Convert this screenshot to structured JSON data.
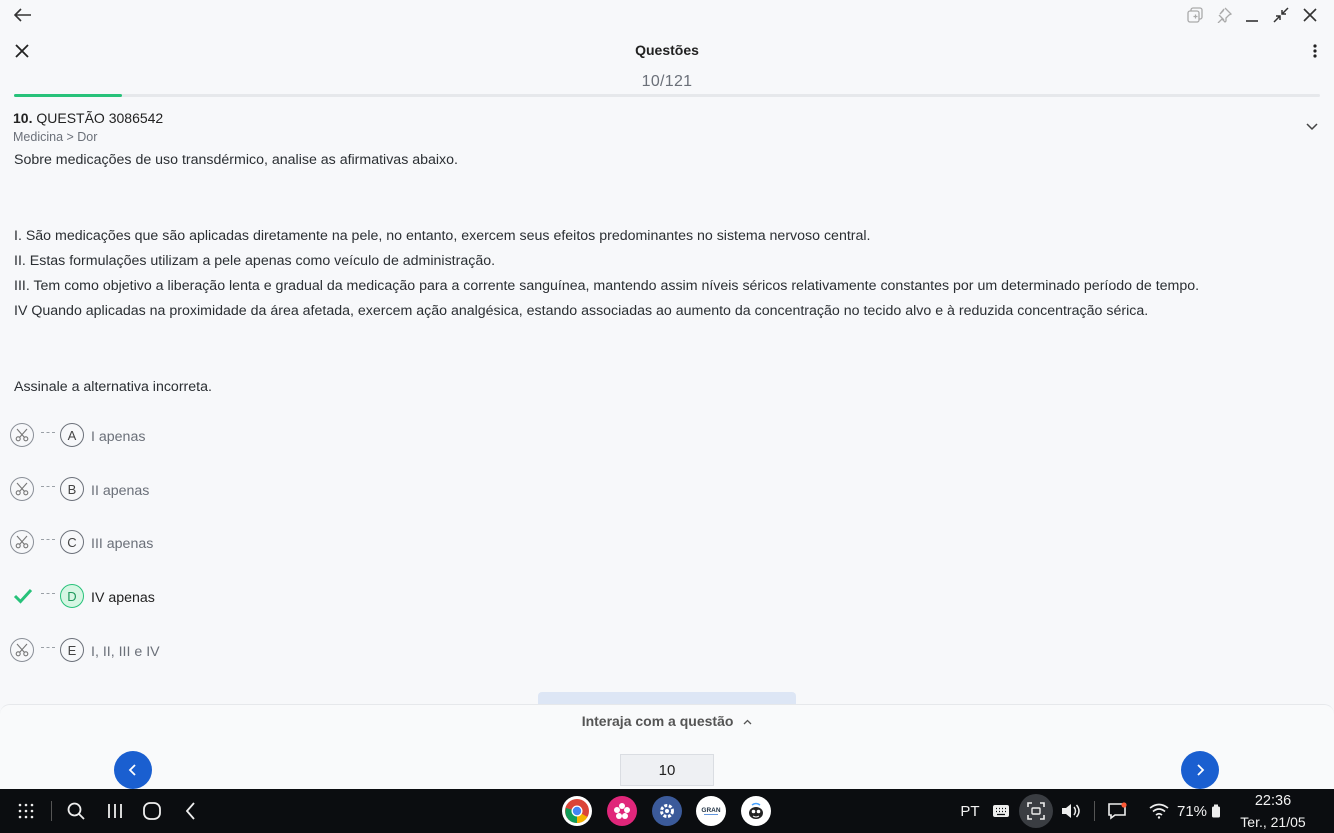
{
  "window": {
    "back_icon": "arrow-left-icon"
  },
  "header": {
    "title": "Questões",
    "counter": "10/121",
    "progress": 0.083
  },
  "question": {
    "number": "10.",
    "code": "QUESTÃO 3086542",
    "category": "Medicina > Dor",
    "intro": "Sobre medicações de uso transdérmico, analise as afirmativas abaixo.",
    "statements": [
      "I. São medicações que são aplicadas diretamente na pele, no entanto, exercem seus efeitos predominantes no sistema nervoso central.",
      "II. Estas formulações utilizam a pele apenas como veículo de administração.",
      "III. Tem como objetivo a liberação lenta e gradual da medicação para a corrente sanguínea, mantendo assim níveis séricos relativamente constantes por um determinado período de tempo.",
      "IV Quando aplicadas na proximidade da área afetada, exercem ação analgésica, estando associadas ao aumento da concentração no tecido alvo e à reduzida concentração sérica."
    ],
    "prompt": "Assinale a alternativa incorreta.",
    "options": [
      {
        "letter": "A",
        "text": "I apenas",
        "correct": false
      },
      {
        "letter": "B",
        "text": "II apenas",
        "correct": false
      },
      {
        "letter": "C",
        "text": "III apenas",
        "correct": false
      },
      {
        "letter": "D",
        "text": "IV apenas",
        "correct": true
      },
      {
        "letter": "E",
        "text": "I, II, III e IV",
        "correct": false
      }
    ]
  },
  "footer": {
    "interact_label": "Interaja com a questão",
    "current_question": "10"
  },
  "taskbar": {
    "language": "PT",
    "battery": "71%",
    "time": "22:36",
    "date": "Ter., 21/05"
  },
  "colors": {
    "accent": "#1a5fd0",
    "success": "#27c27a"
  }
}
